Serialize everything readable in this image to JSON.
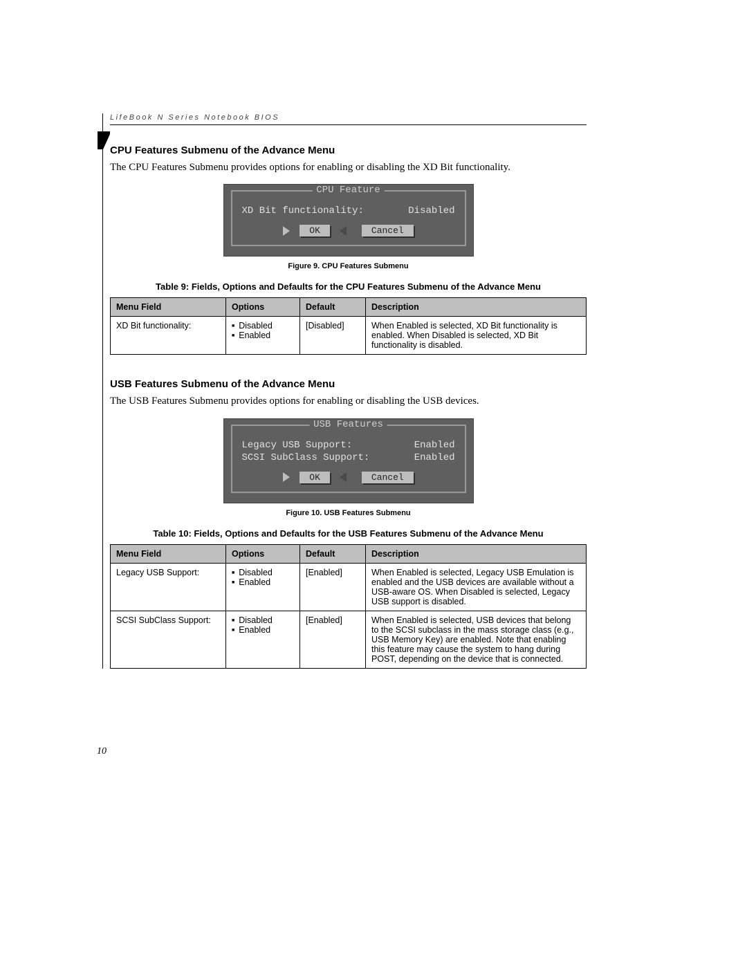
{
  "running_head": "LifeBook N Series Notebook BIOS",
  "page_number": "10",
  "cpu_section": {
    "heading": "CPU Features Submenu of the Advance Menu",
    "body": "The CPU Features Submenu provides options for enabling or disabling the XD Bit functionality.",
    "bios": {
      "title": "CPU Feature",
      "rows": [
        {
          "label": "XD Bit functionality:",
          "value": "Disabled"
        }
      ],
      "ok": "OK",
      "cancel": "Cancel"
    },
    "figure_caption": "Figure 9.  CPU Features Submenu",
    "table_caption": "Table 9: Fields, Options and Defaults for the CPU Features Submenu of the Advance Menu",
    "table": {
      "headers": {
        "menu": "Menu Field",
        "options": "Options",
        "default": "Default",
        "description": "Description"
      },
      "rows": [
        {
          "menu": "XD Bit functionality:",
          "options": [
            "Disabled",
            "Enabled"
          ],
          "default": "[Disabled]",
          "description": "When Enabled is selected, XD Bit functionality is enabled. When Disabled is selected, XD Bit functionality is disabled."
        }
      ]
    }
  },
  "usb_section": {
    "heading": "USB Features Submenu of the Advance Menu",
    "body": "The USB Features Submenu provides options for enabling or disabling the USB devices.",
    "bios": {
      "title": "USB Features",
      "rows": [
        {
          "label": "Legacy USB Support:",
          "value": "Enabled"
        },
        {
          "label": "SCSI SubClass Support:",
          "value": "Enabled"
        }
      ],
      "ok": "OK",
      "cancel": "Cancel"
    },
    "figure_caption": "Figure 10.  USB Features Submenu",
    "table_caption": "Table 10: Fields, Options and Defaults for the USB Features Submenu of the Advance Menu",
    "table": {
      "headers": {
        "menu": "Menu Field",
        "options": "Options",
        "default": "Default",
        "description": "Description"
      },
      "rows": [
        {
          "menu": "Legacy USB Support:",
          "options": [
            "Disabled",
            "Enabled"
          ],
          "default": "[Enabled]",
          "description": "When Enabled is selected, Legacy USB Emulation is enabled and the USB devices are available without a USB-aware OS. When Disabled is selected, Legacy USB support is disabled."
        },
        {
          "menu": "SCSI SubClass Support:",
          "options": [
            "Disabled",
            "Enabled"
          ],
          "default": "[Enabled]",
          "description": "When Enabled is selected, USB devices that belong to the SCSI subclass in the mass storage class (e.g., USB Memory Key) are enabled. Note that enabling this feature may cause the system to hang during POST, depending on the device that is connected."
        }
      ]
    }
  }
}
